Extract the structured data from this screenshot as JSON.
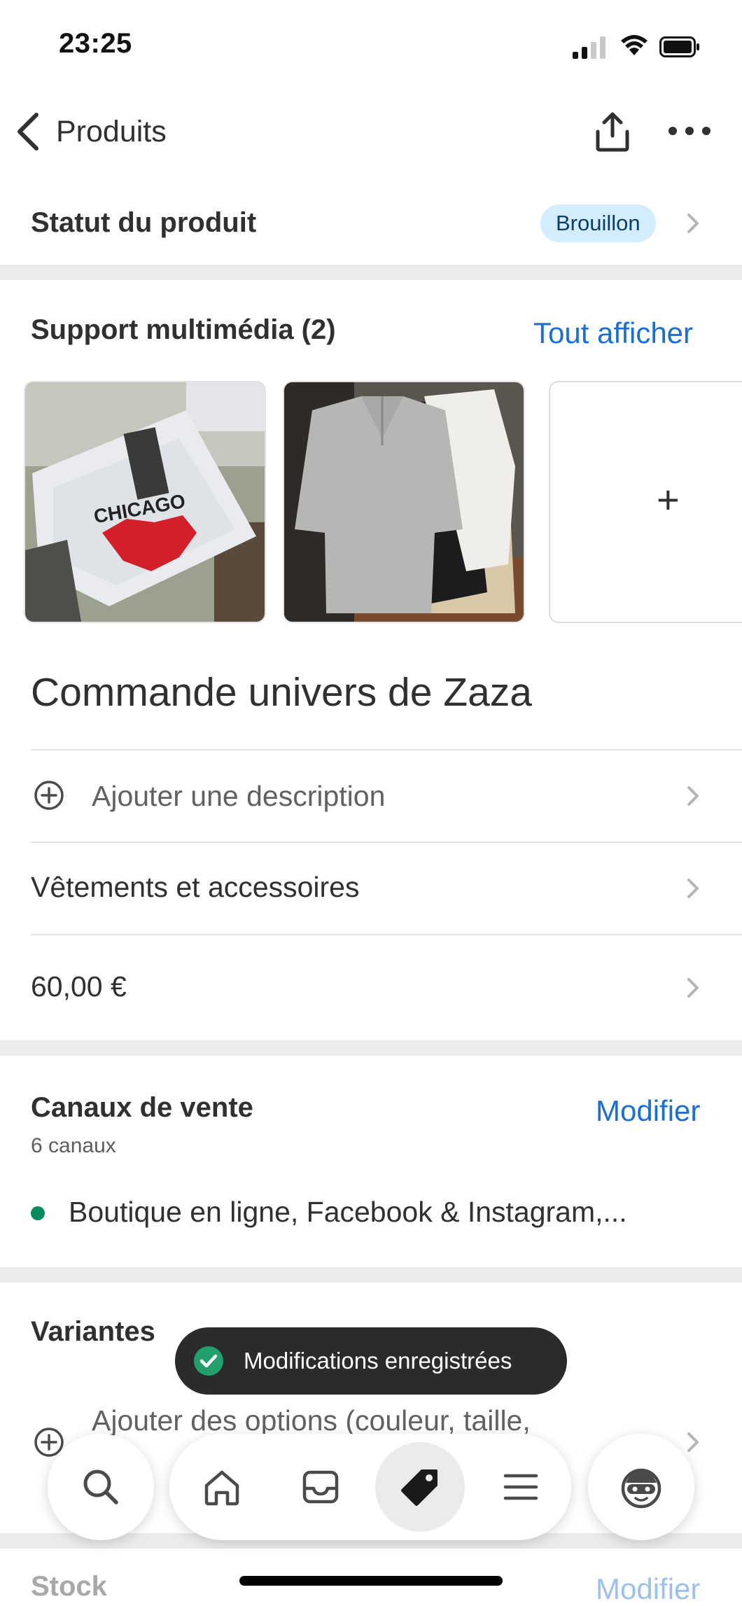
{
  "status_bar": {
    "time": "23:25"
  },
  "header": {
    "back_label": "Produits"
  },
  "product_status": {
    "label": "Statut du produit",
    "badge": "Brouillon"
  },
  "media": {
    "title": "Support multimédia (2)",
    "view_all": "Tout afficher",
    "add_symbol": "+"
  },
  "product": {
    "title": "Commande univers de Zaza",
    "description_placeholder": "Ajouter une description",
    "category": "Vêtements et accessoires",
    "price": "60,00 €"
  },
  "sales_channels": {
    "title": "Canaux de vente",
    "edit": "Modifier",
    "count": "6 canaux",
    "list": "Boutique en ligne, Facebook & Instagram,..."
  },
  "variants": {
    "title": "Variantes",
    "add_options_line1": "Ajouter des options (couleur, taille,",
    "add_options_line2": ")"
  },
  "stock": {
    "title": "Stock",
    "edit": "Modifier"
  },
  "toast": {
    "message": "Modifications enregistrées"
  },
  "colors": {
    "accent": "#1a6fd4",
    "badge_bg": "#d3ecfe",
    "channel_dot": "#0a8a5f"
  }
}
